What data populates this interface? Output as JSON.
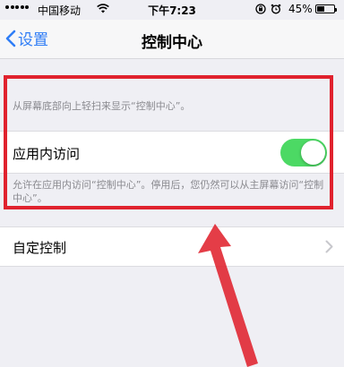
{
  "status_bar": {
    "carrier": "中国移动",
    "time": "下午7:23",
    "battery_percent": "45%",
    "battery_level": 0.45
  },
  "nav": {
    "back_label": "设置",
    "title": "控制中心"
  },
  "settings": {
    "hint_top": "从屏幕底部向上轻扫来显示“控制中心”。",
    "app_access_label": "应用内访问",
    "app_access_enabled": true,
    "hint_bottom": "允许在应用内访问“控制中心”。停用后，您仍然可以从主屏幕访问“控制中心”。",
    "custom_controls_label": "自定控制"
  },
  "colors": {
    "accent": "#2f7df6",
    "toggle_on": "#4cd964",
    "annotation_red": "#e0222e"
  }
}
